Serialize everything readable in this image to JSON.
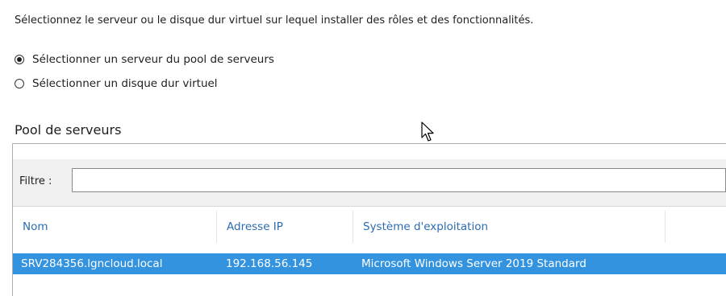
{
  "instruction": "Sélectionnez le serveur ou le disque dur virtuel sur lequel installer des rôles et des fonctionnalités.",
  "options": [
    {
      "label": "Sélectionner un serveur du pool de serveurs",
      "selected": true
    },
    {
      "label": "Sélectionner un disque dur virtuel",
      "selected": false
    }
  ],
  "pool": {
    "title": "Pool de serveurs",
    "filter_label": "Filtre :",
    "filter_value": "",
    "columns": [
      "Nom",
      "Adresse IP",
      "Système d'exploitation"
    ],
    "rows": [
      {
        "name": "SRV284356.lgncloud.local",
        "ip": "192.168.56.145",
        "os": "Microsoft Windows Server 2019 Standard",
        "selected": true
      }
    ]
  },
  "colors": {
    "header_text": "#2b6cb0",
    "selection": "#3393df",
    "filter_background": "#f0f0f0"
  }
}
